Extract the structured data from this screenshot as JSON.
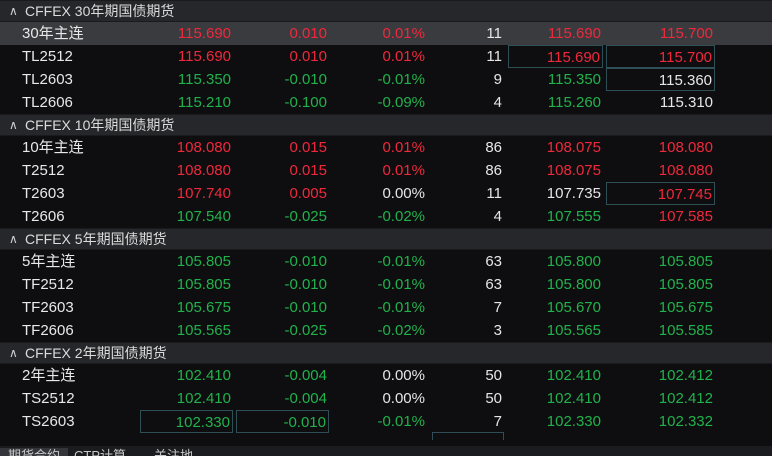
{
  "groups": [
    {
      "title": "CFFEX 30年期国债期货",
      "rows": [
        {
          "name": "30年主连",
          "c1": "115.690",
          "c2": "0.010",
          "c3": "0.01%",
          "c4": "11",
          "c5": "115.690",
          "c6": "115.700",
          "colors": [
            "red",
            "red",
            "red",
            "white",
            "red",
            "red"
          ],
          "selected": true,
          "boxed": []
        },
        {
          "name": "TL2512",
          "c1": "115.690",
          "c2": "0.010",
          "c3": "0.01%",
          "c4": "11",
          "c5": "115.690",
          "c6": "115.700",
          "colors": [
            "red",
            "red",
            "red",
            "white",
            "red",
            "red"
          ],
          "boxed": [
            "c5",
            "c6"
          ]
        },
        {
          "name": "TL2603",
          "c1": "115.350",
          "c2": "-0.010",
          "c3": "-0.01%",
          "c4": "9",
          "c5": "115.350",
          "c6": "115.360",
          "colors": [
            "green",
            "green",
            "green",
            "white",
            "green",
            "white"
          ],
          "boxed": [
            "c6"
          ]
        },
        {
          "name": "TL2606",
          "c1": "115.210",
          "c2": "-0.100",
          "c3": "-0.09%",
          "c4": "4",
          "c5": "115.260",
          "c6": "115.310",
          "colors": [
            "green",
            "green",
            "green",
            "white",
            "green",
            "white"
          ],
          "boxed": []
        }
      ]
    },
    {
      "title": "CFFEX 10年期国债期货",
      "rows": [
        {
          "name": "10年主连",
          "c1": "108.080",
          "c2": "0.015",
          "c3": "0.01%",
          "c4": "86",
          "c5": "108.075",
          "c6": "108.080",
          "colors": [
            "red",
            "red",
            "red",
            "white",
            "red",
            "red"
          ],
          "boxed": []
        },
        {
          "name": "T2512",
          "c1": "108.080",
          "c2": "0.015",
          "c3": "0.01%",
          "c4": "86",
          "c5": "108.075",
          "c6": "108.080",
          "colors": [
            "red",
            "red",
            "red",
            "white",
            "red",
            "red"
          ],
          "boxed": []
        },
        {
          "name": "T2603",
          "c1": "107.740",
          "c2": "0.005",
          "c3": "0.00%",
          "c4": "11",
          "c5": "107.735",
          "c6": "107.745",
          "colors": [
            "red",
            "red",
            "white",
            "white",
            "white",
            "red"
          ],
          "boxed": [
            "c6"
          ]
        },
        {
          "name": "T2606",
          "c1": "107.540",
          "c2": "-0.025",
          "c3": "-0.02%",
          "c4": "4",
          "c5": "107.555",
          "c6": "107.585",
          "colors": [
            "green",
            "green",
            "green",
            "white",
            "green",
            "red"
          ],
          "boxed": []
        }
      ]
    },
    {
      "title": "CFFEX 5年期国债期货",
      "rows": [
        {
          "name": "5年主连",
          "c1": "105.805",
          "c2": "-0.010",
          "c3": "-0.01%",
          "c4": "63",
          "c5": "105.800",
          "c6": "105.805",
          "colors": [
            "green",
            "green",
            "green",
            "white",
            "green",
            "green"
          ],
          "boxed": []
        },
        {
          "name": "TF2512",
          "c1": "105.805",
          "c2": "-0.010",
          "c3": "-0.01%",
          "c4": "63",
          "c5": "105.800",
          "c6": "105.805",
          "colors": [
            "green",
            "green",
            "green",
            "white",
            "green",
            "green"
          ],
          "boxed": []
        },
        {
          "name": "TF2603",
          "c1": "105.675",
          "c2": "-0.010",
          "c3": "-0.01%",
          "c4": "7",
          "c5": "105.670",
          "c6": "105.675",
          "colors": [
            "green",
            "green",
            "green",
            "white",
            "green",
            "green"
          ],
          "boxed": []
        },
        {
          "name": "TF2606",
          "c1": "105.565",
          "c2": "-0.025",
          "c3": "-0.02%",
          "c4": "3",
          "c5": "105.565",
          "c6": "105.585",
          "colors": [
            "green",
            "green",
            "green",
            "white",
            "green",
            "green"
          ],
          "boxed": []
        }
      ]
    },
    {
      "title": "CFFEX 2年期国债期货",
      "rows": [
        {
          "name": "2年主连",
          "c1": "102.410",
          "c2": "-0.004",
          "c3": "0.00%",
          "c4": "50",
          "c5": "102.410",
          "c6": "102.412",
          "colors": [
            "green",
            "green",
            "white",
            "white",
            "green",
            "green"
          ],
          "boxed": []
        },
        {
          "name": "TS2512",
          "c1": "102.410",
          "c2": "-0.004",
          "c3": "0.00%",
          "c4": "50",
          "c5": "102.410",
          "c6": "102.412",
          "colors": [
            "green",
            "green",
            "white",
            "white",
            "green",
            "green"
          ],
          "boxed": []
        },
        {
          "name": "TS2603",
          "c1": "102.330",
          "c2": "-0.010",
          "c3": "-0.01%",
          "c4": "7",
          "c5": "102.330",
          "c6": "102.332",
          "colors": [
            "green",
            "green",
            "green",
            "white",
            "green",
            "green"
          ],
          "boxed": [
            "c1",
            "c2"
          ]
        }
      ]
    }
  ],
  "bottom_tabs": [
    {
      "label": "期货合约",
      "active": true
    },
    {
      "label": "CTP计算",
      "active": false
    },
    {
      "label": "关注地",
      "active": false
    }
  ],
  "icons": {
    "collapse": "chevron-up-icon"
  },
  "colors": {
    "up": "#f0283c",
    "down": "#22b24c",
    "neutral": "#e6e6e6",
    "header_bg": "#26272b",
    "selected_bg": "#3a3b3f"
  }
}
